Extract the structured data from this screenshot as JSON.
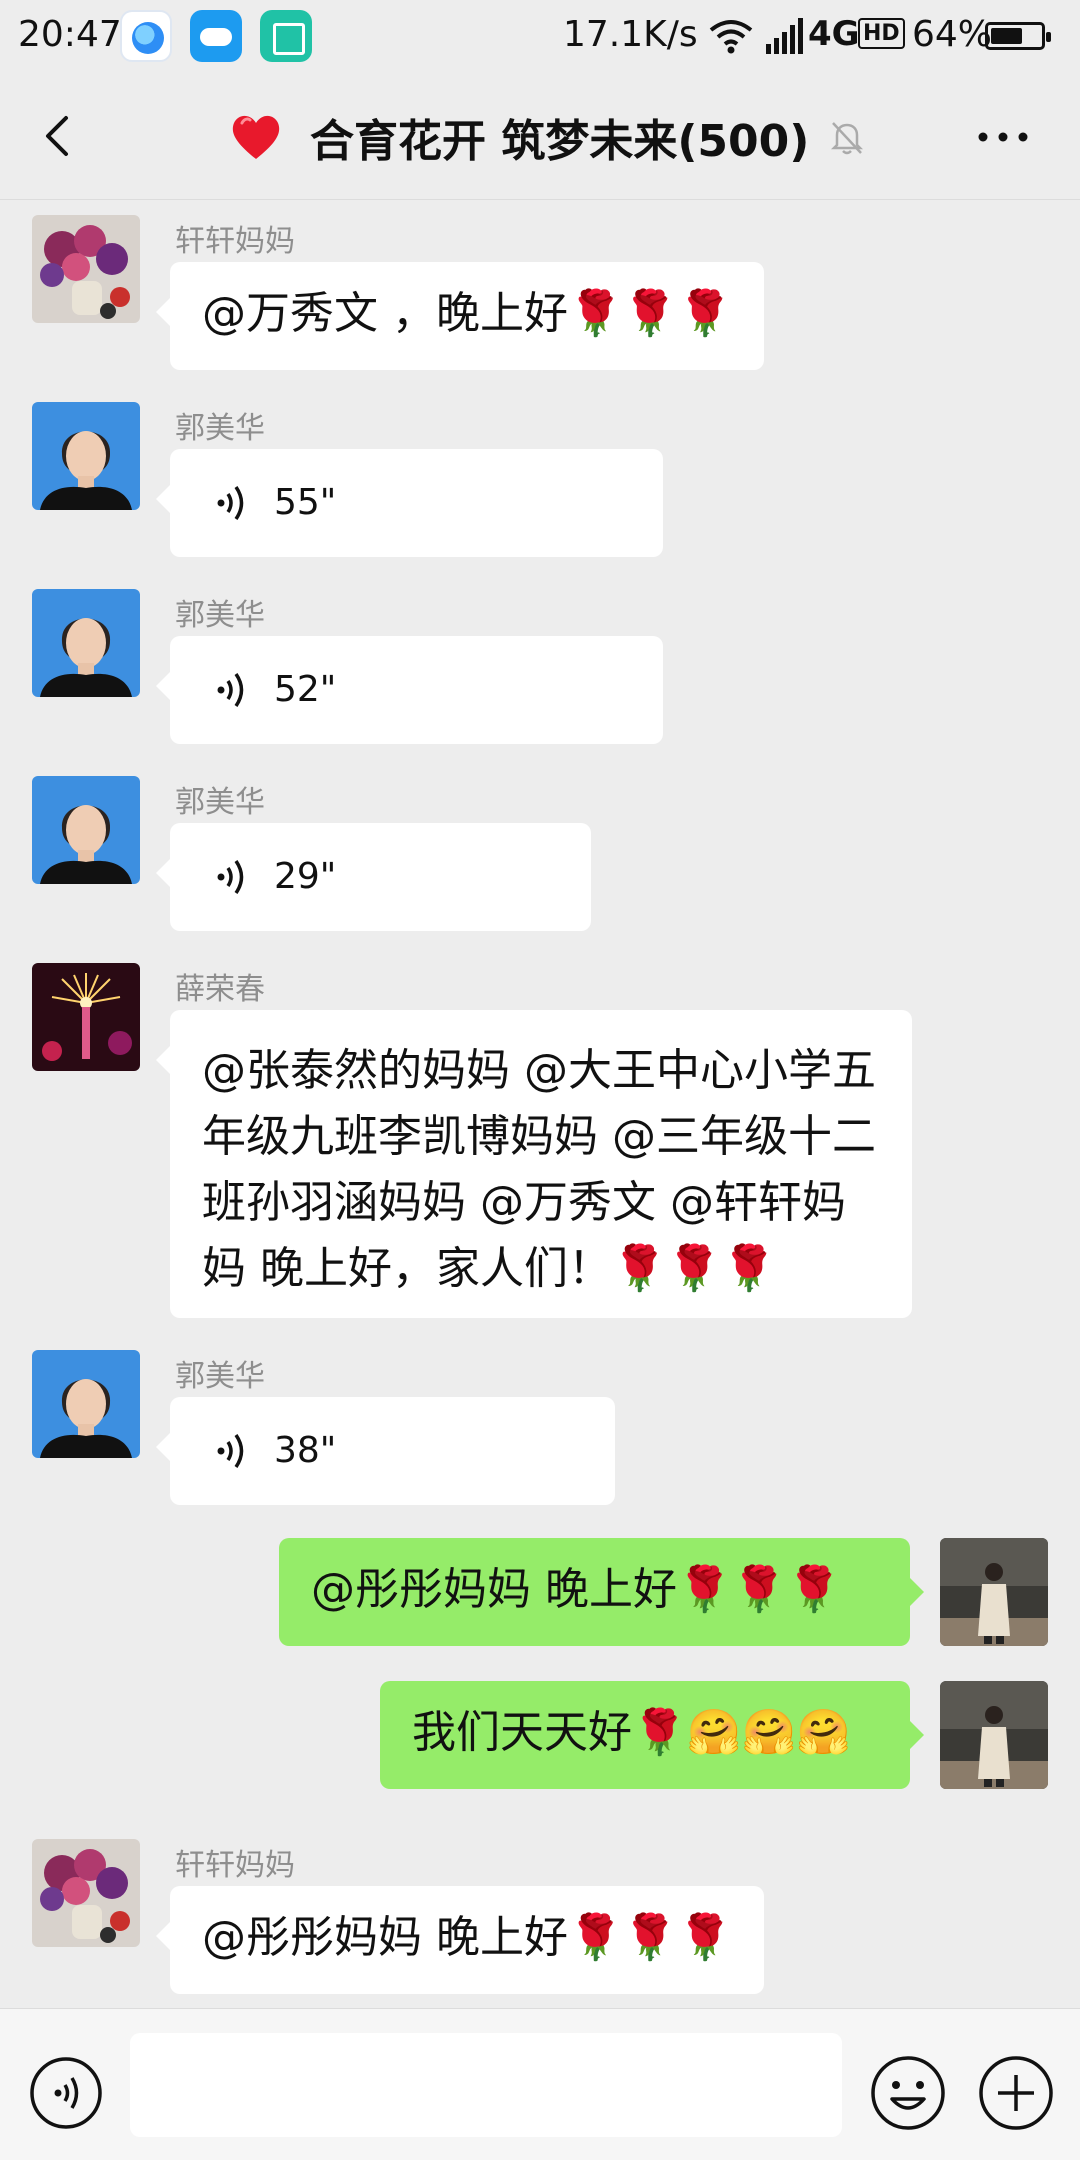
{
  "status_bar": {
    "time": "20:47",
    "net_speed": "17.1K/s",
    "network": "4G",
    "hd": "HD",
    "battery": "64%",
    "battery_level": 0.64,
    "app_icons": [
      "browser-icon",
      "weather-icon",
      "scan-icon"
    ]
  },
  "nav": {
    "title": "合育花开 筑梦未来(500)",
    "icons": [
      "back-icon",
      "heart-icon",
      "mute-bell-icon",
      "more-icon"
    ]
  },
  "messages": [
    {
      "dir": "in",
      "sender": "轩轩妈妈",
      "type": "text",
      "text": "@万秀文 ，晚上好🌹🌹🌹"
    },
    {
      "dir": "in",
      "sender": "郭美华",
      "type": "voice",
      "duration": "55\""
    },
    {
      "dir": "in",
      "sender": "郭美华",
      "type": "voice",
      "duration": "52\""
    },
    {
      "dir": "in",
      "sender": "郭美华",
      "type": "voice",
      "duration": "29\""
    },
    {
      "dir": "in",
      "sender": "薛荣春",
      "type": "text",
      "text": "@张泰然的妈妈 @大王中心小学五年级九班李凯博妈妈 @三年级十二班孙羽涵妈妈 @万秀文 @轩轩妈妈 晚上好，家人们！🌹🌹🌹"
    },
    {
      "dir": "in",
      "sender": "郭美华",
      "type": "voice",
      "duration": "38\""
    },
    {
      "dir": "out",
      "type": "text",
      "text": "@彤彤妈妈  晚上好🌹🌹🌹"
    },
    {
      "dir": "out",
      "type": "text",
      "text": "我们天天好🌹🤗🤗🤗"
    },
    {
      "dir": "in",
      "sender": "轩轩妈妈",
      "type": "text",
      "text": "@彤彤妈妈  晚上好🌹🌹🌹"
    }
  ],
  "input_bar": {
    "placeholder": "",
    "icons": [
      "voice-input-icon",
      "emoji-icon",
      "plus-icon"
    ]
  },
  "colors": {
    "background": "#ededed",
    "incoming_bubble": "#ffffff",
    "outgoing_bubble": "#95ec69",
    "sender_name": "#8e8e8e"
  }
}
